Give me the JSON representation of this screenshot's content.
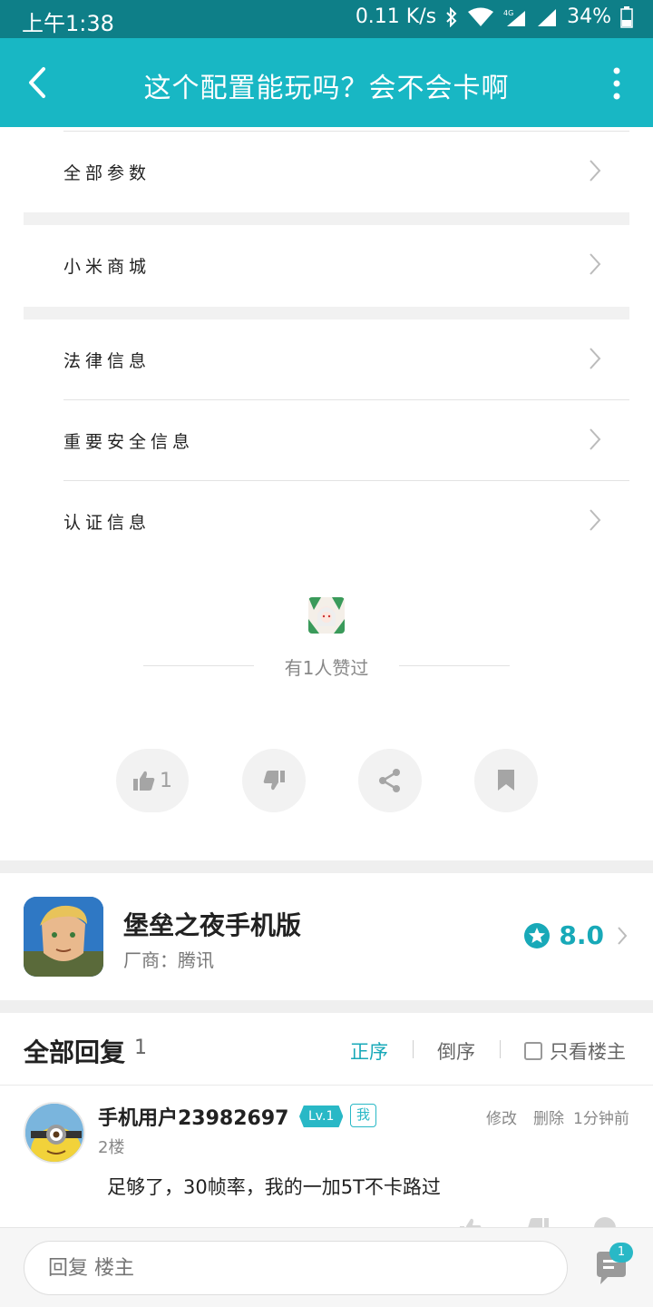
{
  "status_bar": {
    "time": "上午1:38",
    "network_speed": "0.11 K/s",
    "battery": "34%",
    "network_type": "4G"
  },
  "app_bar": {
    "title": "这个配置能玩吗？会不会卡啊"
  },
  "menu": {
    "items": [
      {
        "label": "全部参数"
      },
      {
        "label": "小米商城"
      },
      {
        "label": "法律信息"
      },
      {
        "label": "重要安全信息"
      },
      {
        "label": "认证信息"
      }
    ]
  },
  "likes": {
    "text": "有1人赞过"
  },
  "actions": {
    "like_count": "1"
  },
  "game": {
    "name": "堡垒之夜手机版",
    "vendor": "厂商：腾讯",
    "rating": "8.0"
  },
  "replies": {
    "title": "全部回复",
    "count": "1",
    "sort_asc": "正序",
    "sort_desc": "倒序",
    "only_op": "只看楼主"
  },
  "comment": {
    "user": "手机用户23982697",
    "level": "Lv.1",
    "me": "我",
    "floor": "2楼",
    "edit": "修改",
    "delete": "删除",
    "time": "1分钟前",
    "text": "足够了，30帧率，我的一加5T不卡路过"
  },
  "bottom": {
    "reply_placeholder": "回复 楼主",
    "badge": "1"
  },
  "colors": {
    "accent": "#18b7c4",
    "status_bar": "#0e7f88"
  }
}
